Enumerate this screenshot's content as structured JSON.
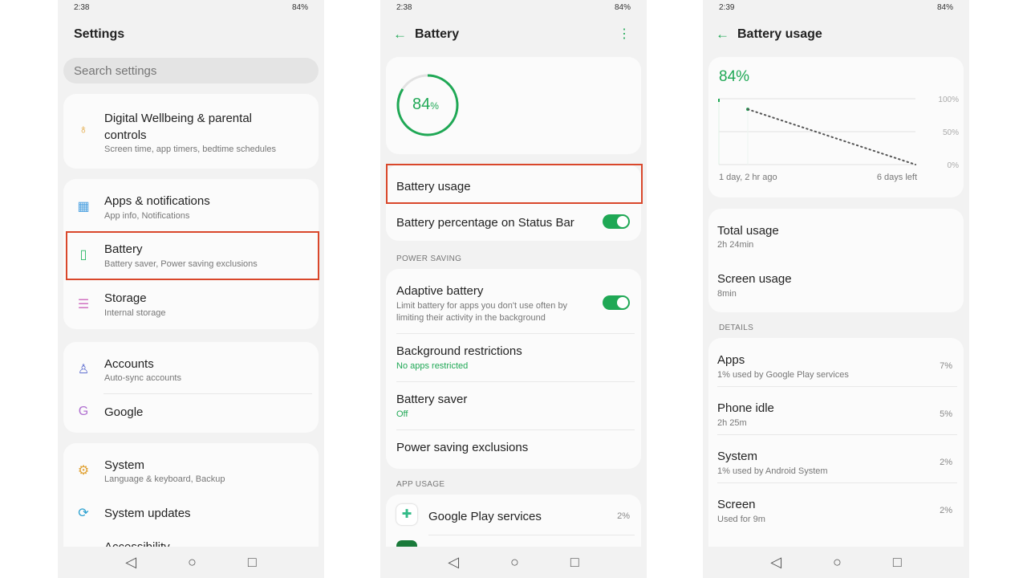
{
  "status": [
    {
      "time": "2:38",
      "battery": "84%"
    },
    {
      "time": "2:38",
      "battery": "84%"
    },
    {
      "time": "2:39",
      "battery": "84%"
    }
  ],
  "settings": {
    "title": "Settings",
    "search_placeholder": "Search settings",
    "items": [
      {
        "label": "Digital Wellbeing & parental controls",
        "sub": "Screen time, app timers, bedtime schedules",
        "icon": "wellbeing-icon"
      },
      {
        "label": "Apps & notifications",
        "sub": "App info, Notifications",
        "icon": "apps-grid-icon"
      },
      {
        "label": "Battery",
        "sub": "Battery saver, Power saving exclusions",
        "icon": "battery-icon"
      },
      {
        "label": "Storage",
        "sub": "Internal storage",
        "icon": "storage-icon"
      },
      {
        "label": "Accounts",
        "sub": "Auto-sync accounts",
        "icon": "accounts-icon"
      },
      {
        "label": "Google",
        "sub": "",
        "icon": "google-icon"
      },
      {
        "label": "System",
        "sub": "Language & keyboard, Backup",
        "icon": "gear-icon"
      },
      {
        "label": "System updates",
        "sub": "",
        "icon": "update-icon"
      },
      {
        "label": "Accessibility",
        "sub": "",
        "icon": "accessibility-icon"
      }
    ]
  },
  "battery": {
    "title": "Battery",
    "level": "84",
    "unit": "%",
    "level_fraction": 0.84,
    "usage": "Battery usage",
    "status_bar_pct": "Battery percentage on Status Bar",
    "status_bar_on": true,
    "power_saving_header": "POWER SAVING",
    "adaptive": "Adaptive battery",
    "adaptive_sub": "Limit battery for apps you don't use often by limiting their activity in the background",
    "adaptive_on": true,
    "bg": "Background restrictions",
    "bg_sub": "No apps restricted",
    "saver": "Battery saver",
    "saver_sub": "Off",
    "exclusions": "Power saving exclusions",
    "app_usage_header": "APP USAGE",
    "apps": [
      {
        "name": "Google Play services",
        "pct": "2%"
      }
    ]
  },
  "usage": {
    "title": "Battery usage",
    "level": "84%",
    "chart_data": {
      "type": "line",
      "yticks": [
        "100%",
        "50%",
        "0%"
      ],
      "ylim": [
        0,
        100
      ],
      "xlabels": [
        "1 day, 2 hr ago",
        "6 days left"
      ],
      "actual_start": 100,
      "current": 84,
      "projection_end": 0
    },
    "total": "Total usage",
    "total_val": "2h 24min",
    "screen": "Screen usage",
    "screen_val": "8min",
    "details_header": "DETAILS",
    "details": [
      {
        "label": "Apps",
        "sub": "1% used by Google Play services",
        "pct": "7%"
      },
      {
        "label": "Phone idle",
        "sub": "2h 25m",
        "pct": "5%"
      },
      {
        "label": "System",
        "sub": "1% used by Android System",
        "pct": "2%"
      },
      {
        "label": "Screen",
        "sub": "Used for 9m",
        "pct": "2%"
      }
    ]
  },
  "colors": {
    "accent": "#1fa855",
    "highlight": "#d9472b"
  }
}
